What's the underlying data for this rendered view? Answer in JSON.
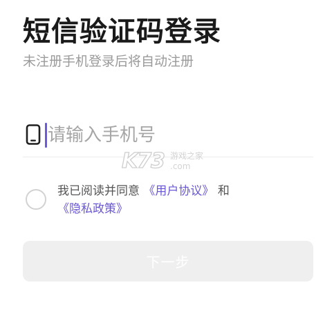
{
  "header": {
    "title": "短信验证码登录",
    "subtitle": "未注册手机登录后将自动注册"
  },
  "phone": {
    "icon": "phone-icon",
    "placeholder": "请输入手机号",
    "value": ""
  },
  "agreement": {
    "prefix": "我已阅读并同意",
    "user_agreement_link": "《用户协议》",
    "conjunction": "和",
    "privacy_policy_link": "《隐私政策》",
    "checked": false
  },
  "actions": {
    "next_label": "下一步"
  },
  "watermark": {
    "logo": "K73",
    "line1": "游戏之家",
    "line2": ".com"
  },
  "colors": {
    "accent": "#6a57d6",
    "caret": "#6d58e0",
    "button_disabled_bg": "#efefef",
    "subtitle": "#9a9a9a",
    "placeholder": "#a6a6a6"
  }
}
